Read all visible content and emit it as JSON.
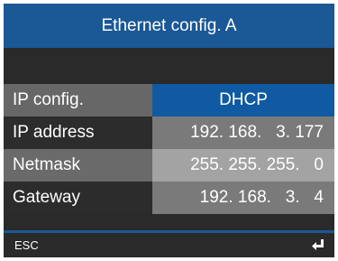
{
  "title": "Ethernet config. A",
  "rows": [
    {
      "label": "IP config.",
      "value": "DHCP"
    },
    {
      "label": "IP address",
      "value": "192. 168.   3. 177"
    },
    {
      "label": "Netmask",
      "value": "255. 255. 255.   0"
    },
    {
      "label": "Gateway",
      "value": "192. 168.   3.   4"
    }
  ],
  "footer": {
    "esc_label": "ESC",
    "enter_icon": "enter-return-icon"
  },
  "colors": {
    "title_bar": "#1a5896",
    "selected_value": "#0f5aa3",
    "background": "#2a2a2a"
  }
}
